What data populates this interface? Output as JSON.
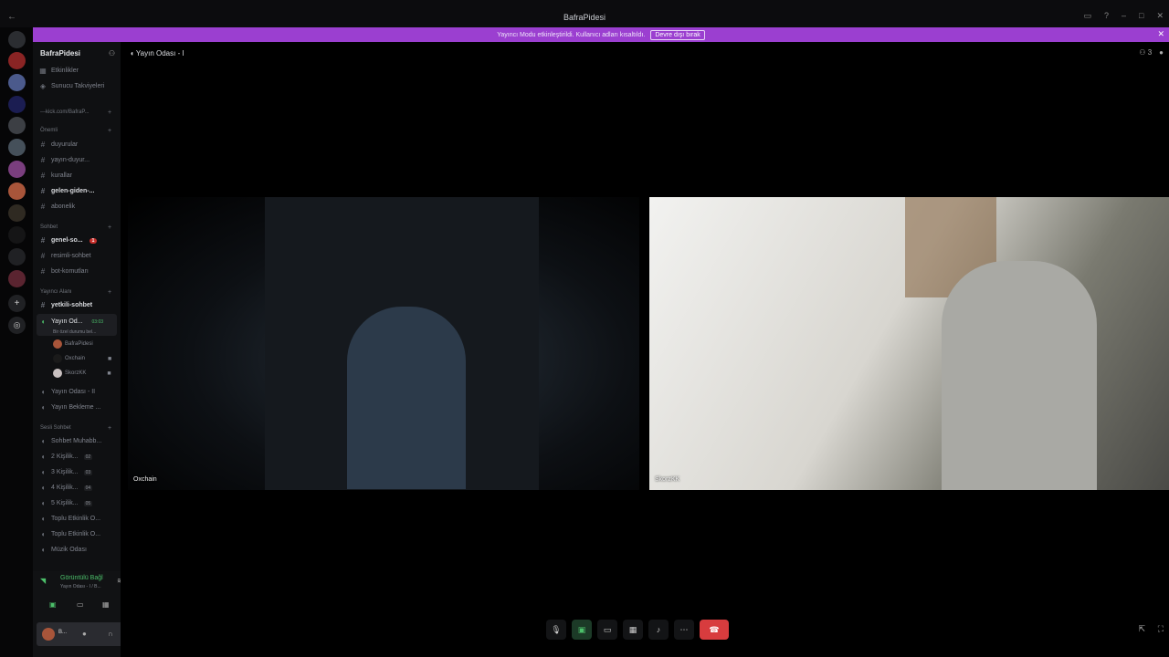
{
  "window": {
    "title": "BafraPidesi"
  },
  "banner": {
    "message": "Yayıncı Modu etkinleştirildi. Kullanıcı adları kısaltıldı.",
    "button": "Devre dışı bırak"
  },
  "server": {
    "name": "BafraPidesi"
  },
  "sidebar": {
    "top_items": [
      "Etkinlikler",
      "Sunucu Takviyeleri"
    ],
    "categories": {
      "kick": "---kick.com/BafraP...",
      "onemli": "Önemli",
      "sohbet": "Sohbet",
      "yayinci": "Yayıncı Alanı",
      "sesli": "Sesli Sohbet"
    },
    "text_channels_onemli": [
      "duyurular",
      "yayın-duyur...",
      "kurallar",
      "gelen-giden-...",
      "abonelik"
    ],
    "text_channels_sohbet": [
      "genel-so...",
      "resimli-sohbet",
      "bot-komutları"
    ],
    "yetkili": "yetkili-sohbet",
    "badge_count": "1",
    "active_voice": {
      "name": "Yayın Od...",
      "time": "03:03",
      "subtitle": "Bir özel durumu bel..."
    },
    "members": [
      "BafraPidesi",
      "Oxchain",
      "SkorzKK"
    ],
    "voice_channels_1": [
      "Yayın Odası - II",
      "Yayın Bekleme ..."
    ],
    "voice_channels_2": [
      {
        "name": "Sohbet Muhabb...",
        "count": ""
      },
      {
        "name": "2 Kişilik...",
        "count": "02"
      },
      {
        "name": "3 Kişilik...",
        "count": "03"
      },
      {
        "name": "4 Kişilik...",
        "count": "04"
      },
      {
        "name": "5 Kişilik...",
        "count": "05"
      },
      {
        "name": "Toplu Etkinlik O...",
        "count": ""
      },
      {
        "name": "Toplu Etkinlik O...",
        "count": ""
      },
      {
        "name": "Müzik Odası",
        "count": ""
      }
    ]
  },
  "voice_panel": {
    "status": "Görüntülü Bağl",
    "channel": "Yayın Odası - I / B...",
    "user": "B..."
  },
  "main": {
    "channel_title": "Yayın Odası - I",
    "member_count": "3",
    "tiles": [
      {
        "label": "Oxchain"
      },
      {
        "label": "SkorzKK"
      }
    ]
  },
  "colors": {
    "accent": "#9b3fd0",
    "green": "#4cbf6a",
    "red": "#d83c3e"
  }
}
